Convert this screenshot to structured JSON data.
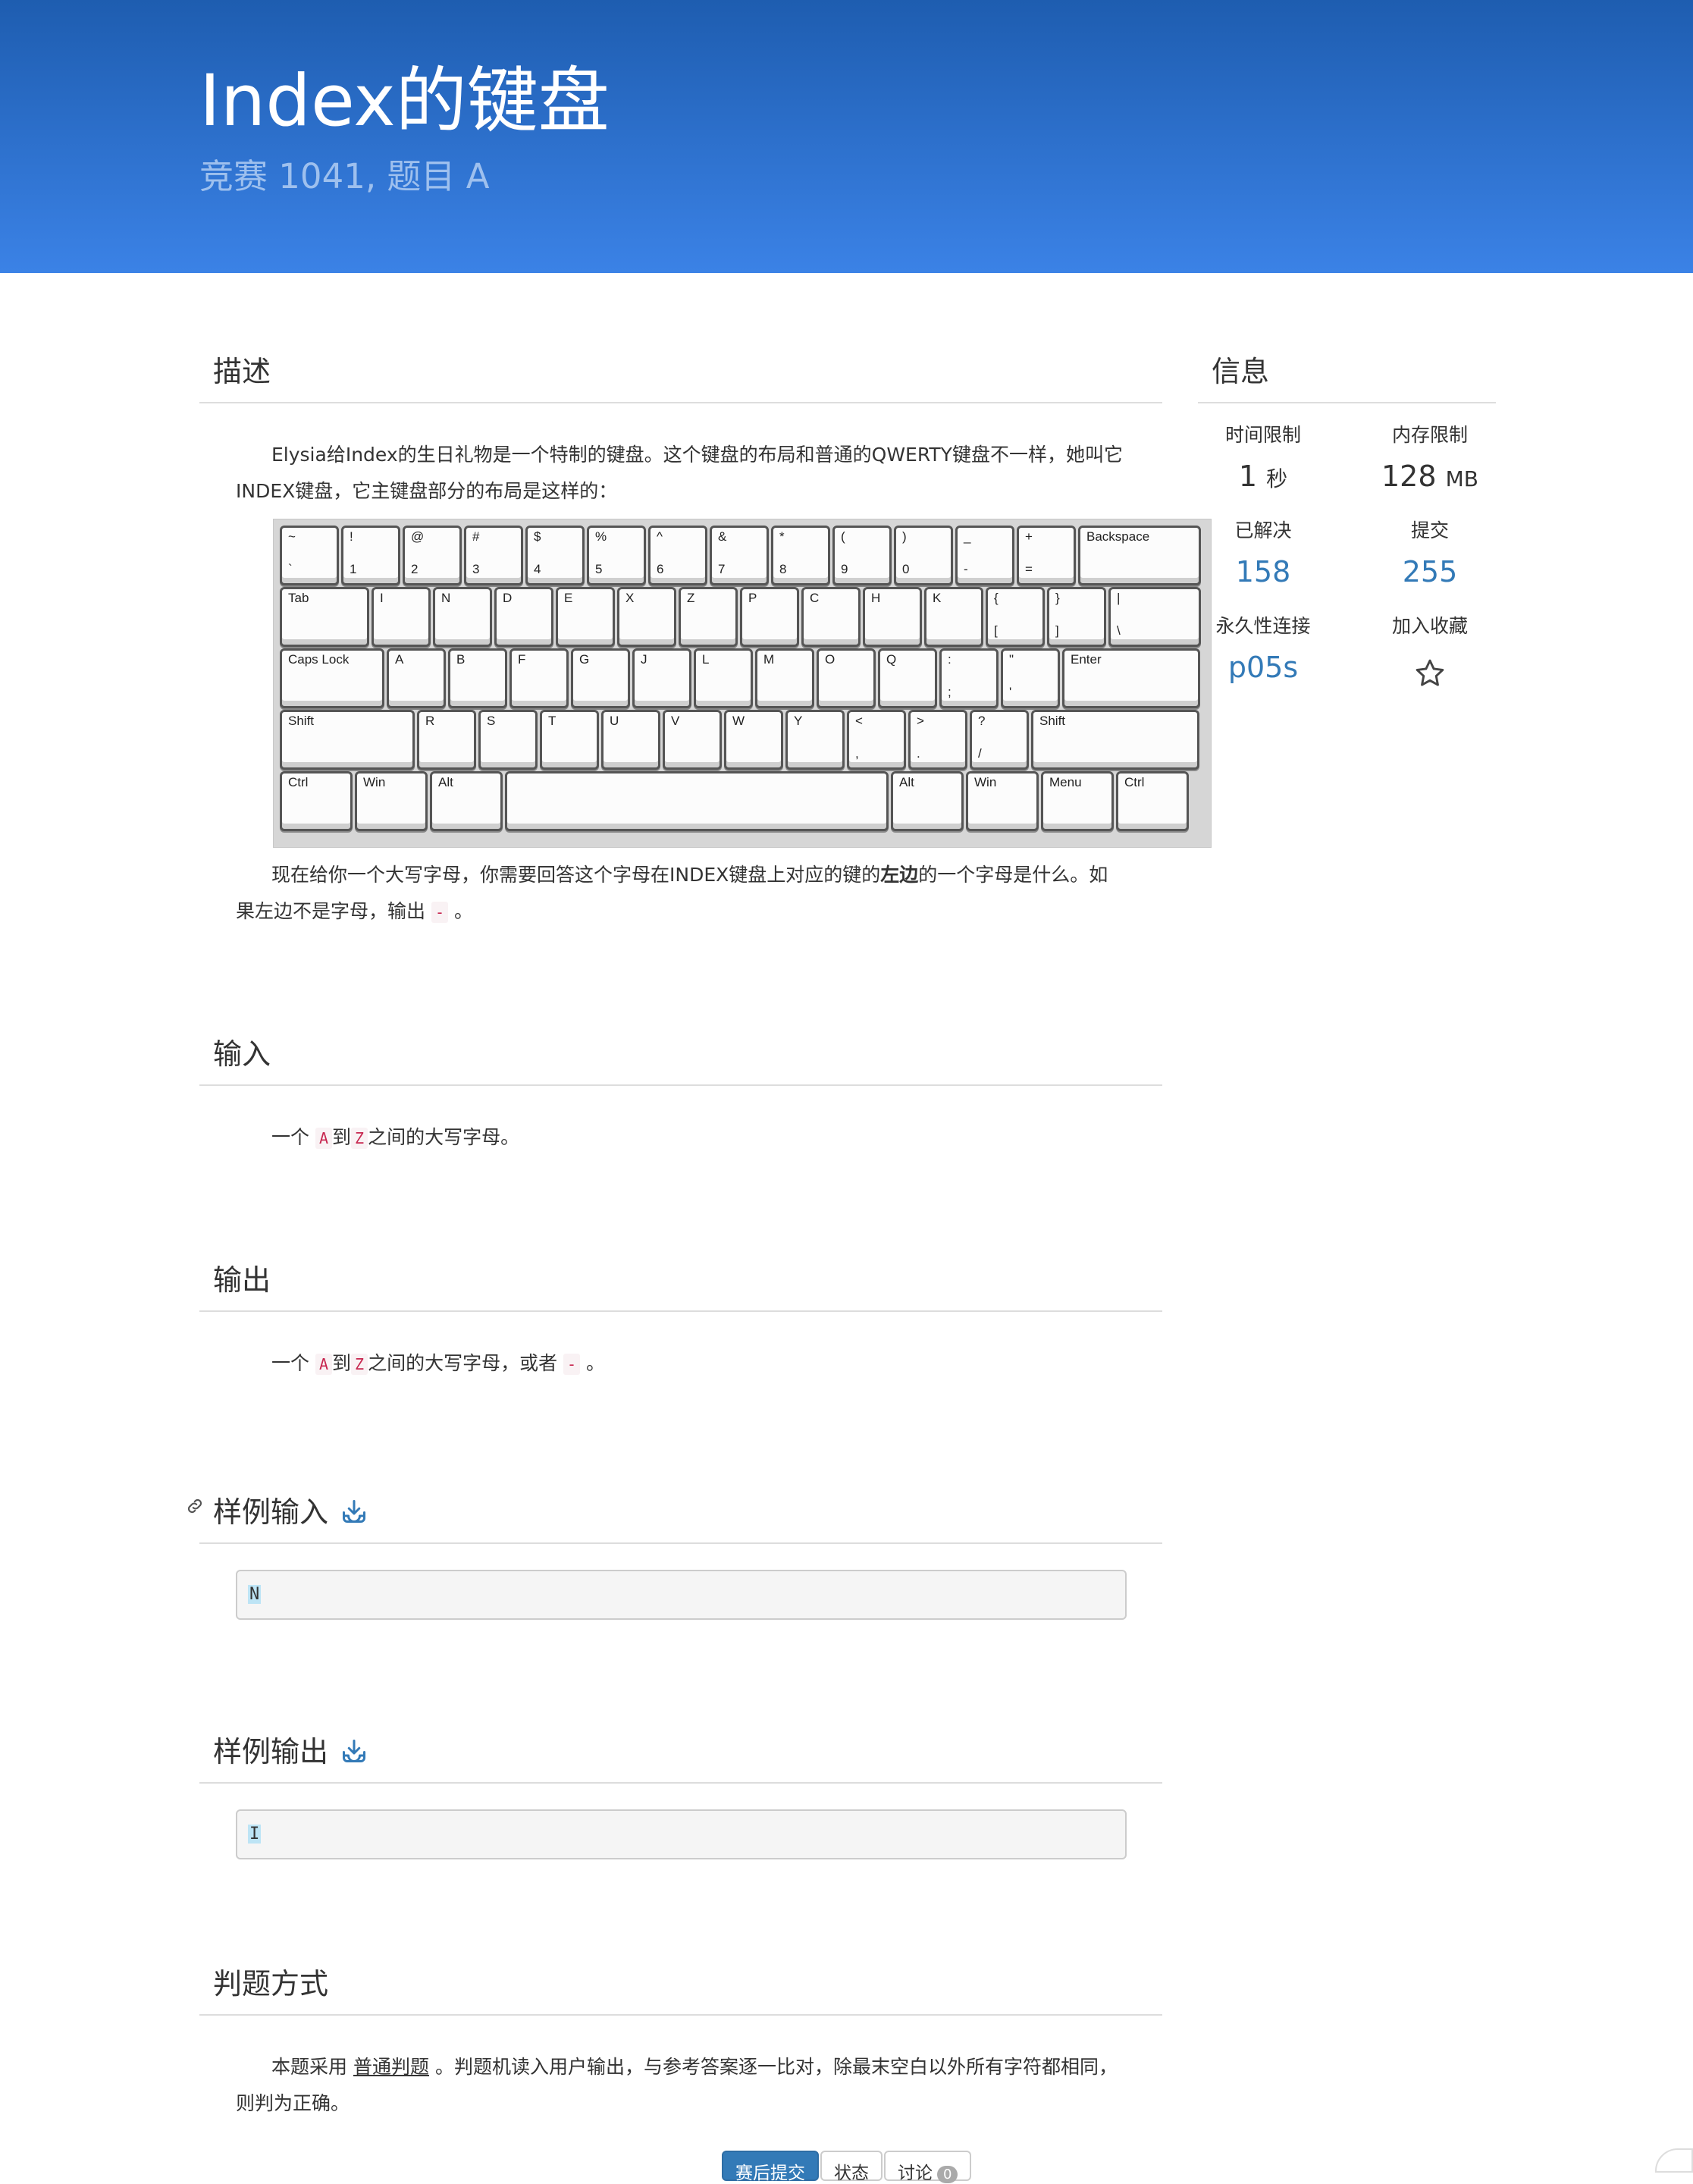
{
  "header": {
    "title": "Index的键盘",
    "subtitle": "竞赛 1041, 题目 A"
  },
  "sections": {
    "description": "描述",
    "input": "输入",
    "output": "输出",
    "sample_input": "样例输入",
    "sample_output": "样例输出",
    "judge": "判题方式"
  },
  "description": {
    "p1": "Elysia给Index的生日礼物是一个特制的键盘。这个键盘的布局和普通的QWERTY键盘不一样，她叫它INDEX键盘，它主键盘部分的布局是这样的：",
    "p2_pre": "现在给你一个大写字母，你需要回答这个字母在INDEX键盘上对应的键的",
    "p2_bold": "左边",
    "p2_post": "的一个字母是什么。如果左边不是字母，输出",
    "p2_code": "-",
    "p2_end": "。"
  },
  "input_text": {
    "pre": "一个",
    "a": "A",
    "mid": "到",
    "z": "Z",
    "post": "之间的大写字母。"
  },
  "output_text": {
    "pre": "一个",
    "a": "A",
    "mid": "到",
    "z": "Z",
    "post": "之间的大写字母，或者",
    "dash": "-",
    "end": "。"
  },
  "sample_input": "N",
  "sample_output": "I",
  "judge_text": {
    "pre": "本题采用",
    "link": "普通判题",
    "post": "。判题机读入用户输出，与参考答案逐一比对，除最末空白以外所有字符都相同，则判为正确。"
  },
  "info": {
    "title": "信息",
    "time_label": "时间限制",
    "time_value": "1",
    "time_unit": "秒",
    "mem_label": "内存限制",
    "mem_value": "128",
    "mem_unit": "MB",
    "solved_label": "已解决",
    "solved_value": "158",
    "submit_label": "提交",
    "submit_value": "255",
    "perma_label": "永久性连接",
    "perma_value": "p05s",
    "fav_label": "加入收藏"
  },
  "buttons": {
    "submit": "赛后提交",
    "status": "状态",
    "discuss": "讨论",
    "discuss_count": "0"
  },
  "keyboard": {
    "row1": [
      [
        "~",
        "`"
      ],
      [
        "!",
        "1"
      ],
      [
        "@",
        "2"
      ],
      [
        "#",
        "3"
      ],
      [
        "$",
        "4"
      ],
      [
        "%",
        "5"
      ],
      [
        "^",
        "6"
      ],
      [
        "&",
        "7"
      ],
      [
        "*",
        "8"
      ],
      [
        "(",
        "9"
      ],
      [
        ")",
        "0"
      ],
      [
        "_",
        "-"
      ],
      [
        "+",
        "="
      ],
      [
        "Backspace",
        ""
      ]
    ],
    "row2": [
      [
        "Tab",
        ""
      ],
      [
        "I",
        ""
      ],
      [
        "N",
        ""
      ],
      [
        "D",
        ""
      ],
      [
        "E",
        ""
      ],
      [
        "X",
        ""
      ],
      [
        "Z",
        ""
      ],
      [
        "P",
        ""
      ],
      [
        "C",
        ""
      ],
      [
        "H",
        ""
      ],
      [
        "K",
        ""
      ],
      [
        "{",
        "["
      ],
      [
        "}",
        "]"
      ],
      [
        "|",
        "\\"
      ]
    ],
    "row3": [
      [
        "Caps Lock",
        ""
      ],
      [
        "A",
        ""
      ],
      [
        "B",
        ""
      ],
      [
        "F",
        ""
      ],
      [
        "G",
        ""
      ],
      [
        "J",
        ""
      ],
      [
        "L",
        ""
      ],
      [
        "M",
        ""
      ],
      [
        "O",
        ""
      ],
      [
        "Q",
        ""
      ],
      [
        ":",
        ";"
      ],
      [
        "\"",
        "'"
      ],
      [
        "Enter",
        ""
      ]
    ],
    "row4": [
      [
        "Shift",
        ""
      ],
      [
        "R",
        ""
      ],
      [
        "S",
        ""
      ],
      [
        "T",
        ""
      ],
      [
        "U",
        ""
      ],
      [
        "V",
        ""
      ],
      [
        "W",
        ""
      ],
      [
        "Y",
        ""
      ],
      [
        "<",
        ","
      ],
      [
        ">",
        "."
      ],
      [
        "?",
        "/"
      ],
      [
        "Shift",
        ""
      ]
    ],
    "row5": [
      [
        "Ctrl",
        ""
      ],
      [
        "Win",
        ""
      ],
      [
        "Alt",
        ""
      ],
      [
        "",
        ""
      ],
      [
        "Alt",
        ""
      ],
      [
        "Win",
        ""
      ],
      [
        "Menu",
        ""
      ],
      [
        "Ctrl",
        ""
      ]
    ]
  }
}
